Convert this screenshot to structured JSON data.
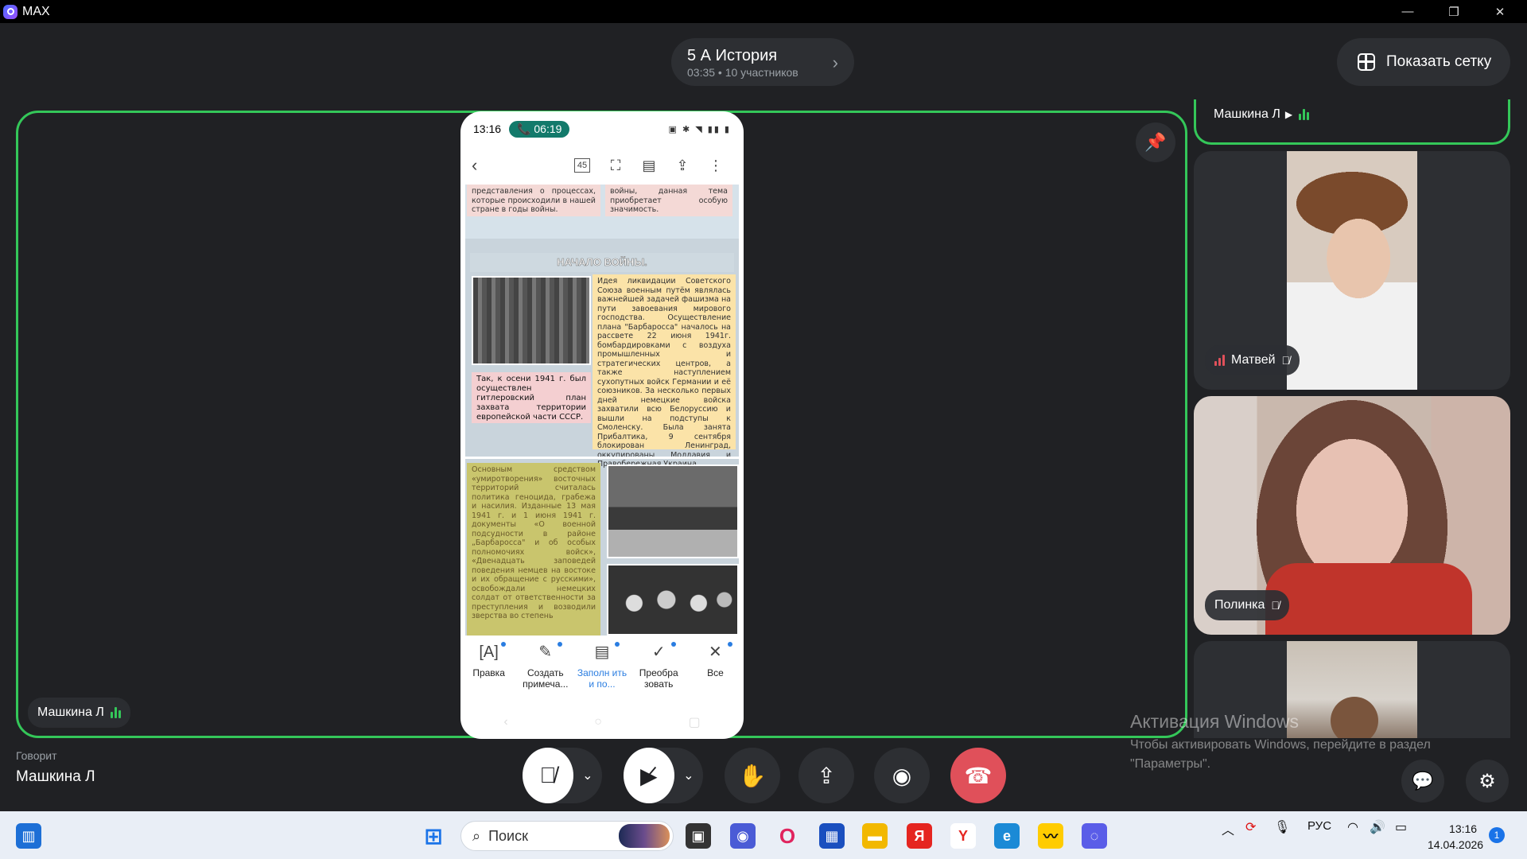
{
  "window": {
    "app_name": "MAX",
    "minimize": "—",
    "maximize": "❐",
    "close": "✕"
  },
  "header": {
    "call_title": "5 А История",
    "call_meta": "03:35 • 10 участников",
    "show_grid": "Показать сетку"
  },
  "stage": {
    "presenter_name": "Машкина Л"
  },
  "phone": {
    "time": "13:16",
    "call_timer": "06:19",
    "page_count": "45",
    "sec1_left": "представления о процессах, которые происходили в нашей стране в годы войны.",
    "sec1_right": "войны, данная тема приобретает особую значимость.",
    "section_title": "НАЧАЛО ВОЙНЫ.",
    "box_right": "Идея ликвидации Советского Союза военным путём являлась важнейшей задачей фашизма на пути завоевания мирового господства. Осуществление плана \"Барбаросса\" началось на рассвете 22 июня 1941г. бомбардировками с воздуха промышленных и стратегических центров, а также наступлением сухопутных войск Германии и её союзников. За несколько первых дней немецкие войска захватили всю Белоруссию и вышли на подступы к Смоленску. Была занята Прибалтика, 9 сентября блокирован Ленинград, оккупированы Молдавия и Правобережная Украина.",
    "box_left": "Так, к осени 1941 г. был осуществлен гитлеровский план захвата территории европейской части СССР.",
    "box_bottom": "Основным средством «умиротворения» восточных территорий считалась политика геноцида, грабежа и насилия. Изданные 13 мая 1941 г. и 1 июня 1941 г. документы «О военной подсудности в районе „Барбаросса\" и об особых полномочиях войск», «Двенадцать заповедей поведения немцев на востоке и их обращение с русскими», освобождали немецких солдат от ответственности за преступления и возводили зверства во степень",
    "tools": [
      {
        "label": "Правка",
        "icon": "[A]"
      },
      {
        "label": "Создать примеча...",
        "icon": "✎"
      },
      {
        "label": "Заполн ить и по...",
        "icon": "▤"
      },
      {
        "label": "Преобра зовать",
        "icon": "✓"
      },
      {
        "label": "Все",
        "icon": "✕"
      }
    ]
  },
  "participants": [
    {
      "name": "Машкина Л"
    },
    {
      "name": "Матвей"
    },
    {
      "name": "Полинка"
    }
  ],
  "speaker": {
    "label": "Говорит",
    "name": "Машкина Л"
  },
  "watermark": {
    "title": "Активация Windows",
    "line1": "Чтобы активировать Windows, перейдите в раздел",
    "line2": "\"Параметры\"."
  },
  "taskbar": {
    "search_placeholder": "Поиск",
    "lang": "РУС",
    "time": "13:16",
    "date": "14.04.2026",
    "notif_count": "1"
  },
  "colors": {
    "accent_green": "#34c759",
    "end_call": "#e0505a"
  }
}
